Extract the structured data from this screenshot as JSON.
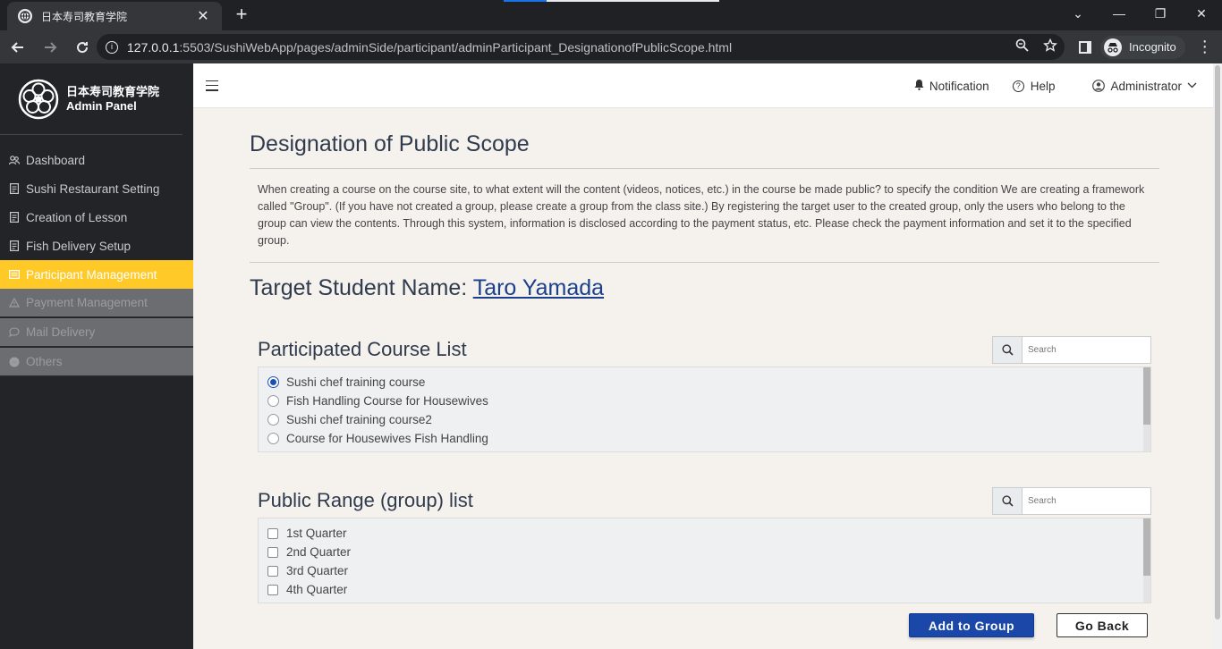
{
  "browser": {
    "tab_title": "日本寿司教育学院",
    "new_tab": "+",
    "tab_close": "✕",
    "url_host": "127.0.0.1",
    "url_rest": ":5503/SushiWebApp/pages/adminSide/participant/adminParticipant_DesignationofPublicScope.html",
    "incognito_label": "Incognito",
    "win_minimize": "⌄",
    "win_min": "—",
    "win_restore": "❐",
    "win_close": "✕"
  },
  "sidebar": {
    "brand_line1": "日本寿司教育学院",
    "brand_line2": "Admin Panel",
    "items": [
      {
        "label": "Dashboard",
        "icon": "users-icon",
        "state": "normal"
      },
      {
        "label": "Sushi Restaurant Setting",
        "icon": "doc-icon",
        "state": "normal"
      },
      {
        "label": "Creation of Lesson",
        "icon": "doc-icon",
        "state": "normal"
      },
      {
        "label": "Fish Delivery Setup",
        "icon": "doc-icon",
        "state": "normal"
      },
      {
        "label": "Participant Management",
        "icon": "card-icon",
        "state": "active"
      },
      {
        "label": "Payment Management",
        "icon": "warning-icon",
        "state": "disabled"
      },
      {
        "label": "Mail Delivery",
        "icon": "chat-icon",
        "state": "disabled"
      },
      {
        "label": "Others",
        "icon": "messenger-icon",
        "state": "disabled"
      }
    ]
  },
  "topbar": {
    "notification": "Notification",
    "help": "Help",
    "user": "Administrator"
  },
  "main": {
    "title": "Designation of Public Scope",
    "description": "When creating a course on the course site, to what extent will the content (videos, notices, etc.) in the course be made public? to specify the condition We are creating a framework called \"Group\". (If you have not created a group, please create a group from the class site.) By registering the target user to the created group, only the users who belong to the group can view the contents. Through this system, information is disclosed according to the payment status, etc. Please check the payment information and set it to the specified group.",
    "student_label": "Target Student Name: ",
    "student_name": "Taro Yamada",
    "course_section": {
      "title": "Participated Course List",
      "search_placeholder": "Search",
      "options": [
        {
          "label": "Sushi chef training course",
          "checked": true
        },
        {
          "label": "Fish Handling Course for Housewives",
          "checked": false
        },
        {
          "label": "Sushi chef training course2",
          "checked": false
        },
        {
          "label": "Course for Housewives Fish Handling",
          "checked": false
        }
      ]
    },
    "group_section": {
      "title": "Public Range (group) list",
      "search_placeholder": "Search",
      "options": [
        {
          "label": "1st Quarter",
          "checked": false
        },
        {
          "label": "2nd Quarter",
          "checked": false
        },
        {
          "label": "3rd Quarter",
          "checked": false
        },
        {
          "label": "4th Quarter",
          "checked": false
        }
      ]
    },
    "buttons": {
      "add": "Add to Group",
      "back": "Go Back"
    }
  }
}
